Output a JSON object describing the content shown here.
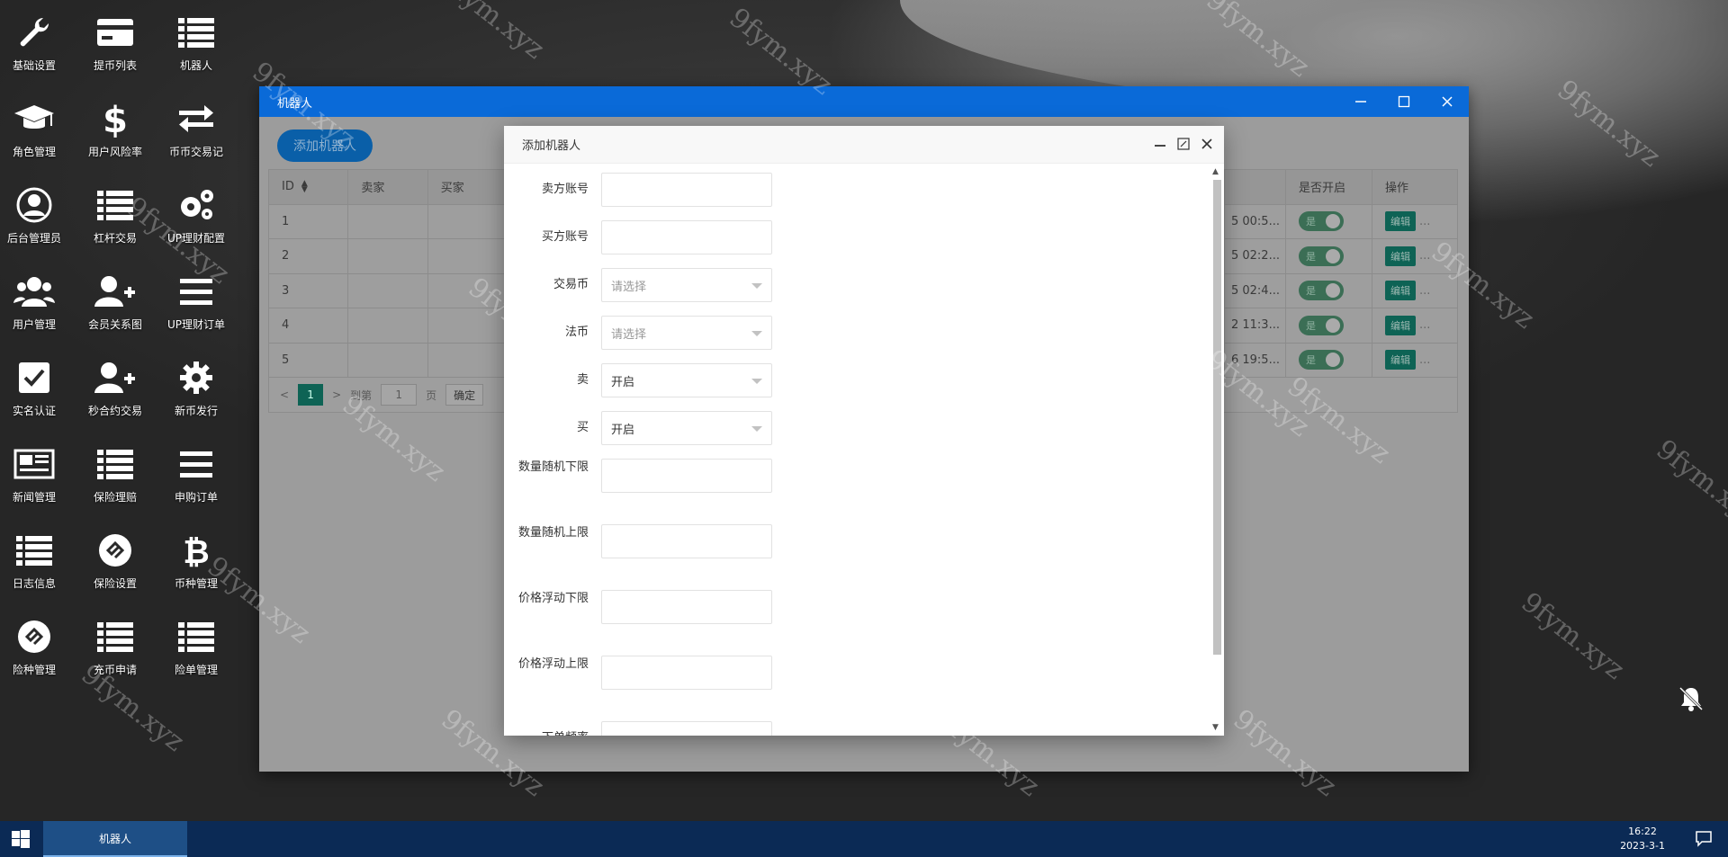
{
  "desktop_icons": [
    {
      "label": "基础设置",
      "icon": "wrench-icon"
    },
    {
      "label": "提币列表",
      "icon": "card-icon"
    },
    {
      "label": "机器人",
      "icon": "list-icon"
    },
    {
      "label": "角色管理",
      "icon": "graduation-cap-icon"
    },
    {
      "label": "用户风险率",
      "icon": "dollar-icon"
    },
    {
      "label": "币币交易记",
      "icon": "exchange-icon"
    },
    {
      "label": "后台管理员",
      "icon": "user-circle-icon"
    },
    {
      "label": "杠杆交易",
      "icon": "list-icon"
    },
    {
      "label": "UP理财配置",
      "icon": "gears-icon"
    },
    {
      "label": "用户管理",
      "icon": "users-icon"
    },
    {
      "label": "会员关系图",
      "icon": "user-plus-icon"
    },
    {
      "label": "UP理财订单",
      "icon": "bars-icon"
    },
    {
      "label": "实名认证",
      "icon": "check-square-icon"
    },
    {
      "label": "秒合约交易",
      "icon": "user-plus-icon"
    },
    {
      "label": "新币发行",
      "icon": "gear-icon"
    },
    {
      "label": "新闻管理",
      "icon": "newspaper-icon"
    },
    {
      "label": "保险理赔",
      "icon": "list-icon"
    },
    {
      "label": "申购订单",
      "icon": "bars-icon"
    },
    {
      "label": "日志信息",
      "icon": "list-icon"
    },
    {
      "label": "保险设置",
      "icon": "logo-circle-icon"
    },
    {
      "label": "币种管理",
      "icon": "bitcoin-icon"
    },
    {
      "label": "险种管理",
      "icon": "logo-circle-icon"
    },
    {
      "label": "充币申请",
      "icon": "list-icon"
    },
    {
      "label": "险单管理",
      "icon": "list-icon"
    }
  ],
  "window": {
    "title": "机器人",
    "add_button": "添加机器人",
    "columns": [
      "ID",
      "卖家",
      "买家",
      "是否开启",
      "操作"
    ],
    "rows": [
      {
        "id": "1",
        "time": "5 00:5...",
        "open": "是",
        "edit": "编辑",
        "more": "..."
      },
      {
        "id": "2",
        "time": "5 02:2...",
        "open": "是",
        "edit": "编辑",
        "more": "..."
      },
      {
        "id": "3",
        "time": "5 02:4...",
        "open": "是",
        "edit": "编辑",
        "more": "..."
      },
      {
        "id": "4",
        "time": "2 11:3...",
        "open": "是",
        "edit": "编辑",
        "more": "..."
      },
      {
        "id": "5",
        "time": "6 19:5...",
        "open": "是",
        "edit": "编辑",
        "more": "..."
      }
    ],
    "pager": {
      "current": "1",
      "goto_label": "到第",
      "goto_value": "1",
      "page_label": "页",
      "confirm": "确定"
    }
  },
  "modal": {
    "title": "添加机器人",
    "fields": [
      {
        "label": "卖方账号",
        "value": "",
        "type": "input"
      },
      {
        "label": "买方账号",
        "value": "",
        "type": "input"
      },
      {
        "label": "交易币",
        "value": "请选择",
        "type": "select-placeholder"
      },
      {
        "label": "法币",
        "value": "请选择",
        "type": "select-placeholder"
      },
      {
        "label": "卖",
        "value": "开启",
        "type": "select"
      },
      {
        "label": "买",
        "value": "开启",
        "type": "select"
      },
      {
        "label": "数量随机下限",
        "value": "",
        "type": "input"
      },
      {
        "label": "数量随机上限",
        "value": "",
        "type": "input"
      },
      {
        "label": "价格浮动下限",
        "value": "",
        "type": "input"
      },
      {
        "label": "价格浮动上限",
        "value": "",
        "type": "input"
      },
      {
        "label": "下单频率",
        "value": "",
        "type": "input"
      }
    ]
  },
  "taskbar": {
    "task": "机器人",
    "time": "16:22",
    "date": "2023-3-1"
  },
  "watermark": "9fym.xyz"
}
